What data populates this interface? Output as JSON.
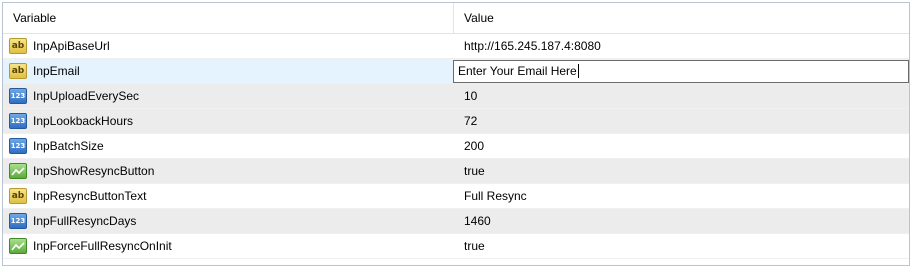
{
  "table": {
    "header": {
      "variable": "Variable",
      "value": "Value"
    },
    "rows": [
      {
        "name": "InpApiBaseUrl",
        "value": "http://165.245.187.4:8080",
        "type_icon": "ab-string-icon"
      },
      {
        "name": "InpEmail",
        "value": "Enter Your Email Here",
        "type_icon": "ab-string-icon",
        "editing": true
      },
      {
        "name": "InpUploadEverySec",
        "value": "10",
        "type_icon": "123-number-icon"
      },
      {
        "name": "InpLookbackHours",
        "value": "72",
        "type_icon": "123-number-icon"
      },
      {
        "name": "InpBatchSize",
        "value": "200",
        "type_icon": "123-number-icon"
      },
      {
        "name": "InpShowResyncButton",
        "value": "true",
        "type_icon": "bool-chart-icon"
      },
      {
        "name": "InpResyncButtonText",
        "value": "Full Resync",
        "type_icon": "ab-string-icon"
      },
      {
        "name": "InpFullResyncDays",
        "value": "1460",
        "type_icon": "123-number-icon"
      },
      {
        "name": "InpForceFullResyncOnInit",
        "value": "true",
        "type_icon": "bool-chart-icon"
      }
    ]
  }
}
